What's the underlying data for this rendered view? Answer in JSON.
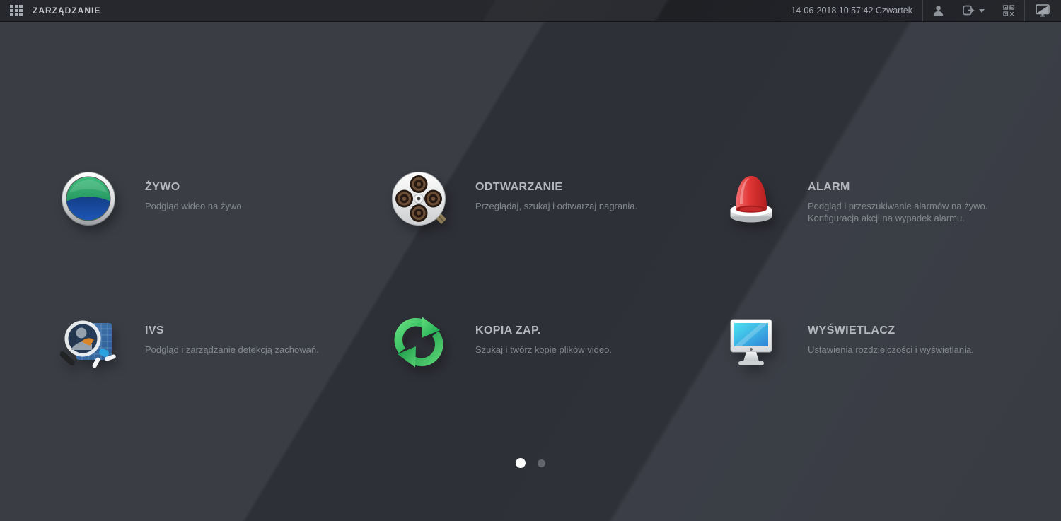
{
  "topbar": {
    "app_title": "ZARZĄDZANIE",
    "datetime": "14-06-2018 10:57:42 Czwartek"
  },
  "tiles": [
    {
      "title": "ŻYWO",
      "desc": "Podgląd wideo na żywo.",
      "icon": "live-lens-icon"
    },
    {
      "title": "ODTWARZANIE",
      "desc": "Przeglądaj, szukaj i odtwarzaj nagrania.",
      "icon": "film-reel-icon"
    },
    {
      "title": "ALARM",
      "desc": "Podgląd i przeszukiwanie alarmów na żywo.",
      "desc2": "Konfiguracja akcji na wypadek alarmu.",
      "icon": "siren-icon"
    },
    {
      "title": "IVS",
      "desc": "Podgląd i zarządzanie detekcją zachowań.",
      "icon": "behavior-search-icon"
    },
    {
      "title": "KOPIA ZAP.",
      "desc": "Szukaj i twórz kopie plików video.",
      "icon": "backup-sync-icon"
    },
    {
      "title": "WYŚWIETLACZ",
      "desc": "Ustawienia rozdzielczości i wyświetlania.",
      "icon": "monitor-icon"
    }
  ],
  "pagination": {
    "dots": 2,
    "active_index": 0
  },
  "colors": {
    "background_light": "#3a3d44",
    "background_dark": "#2e3037",
    "topbar": "#26282d",
    "title_text": "#b4b8be",
    "desc_text": "#83878e",
    "lens_green": "#2fae67",
    "lens_blue": "#1b50b0",
    "alarm_red": "#d93232",
    "backup_green": "#2fbd58",
    "screen_cyan": "#3ed2ea",
    "active_dot": "#ffffff"
  }
}
